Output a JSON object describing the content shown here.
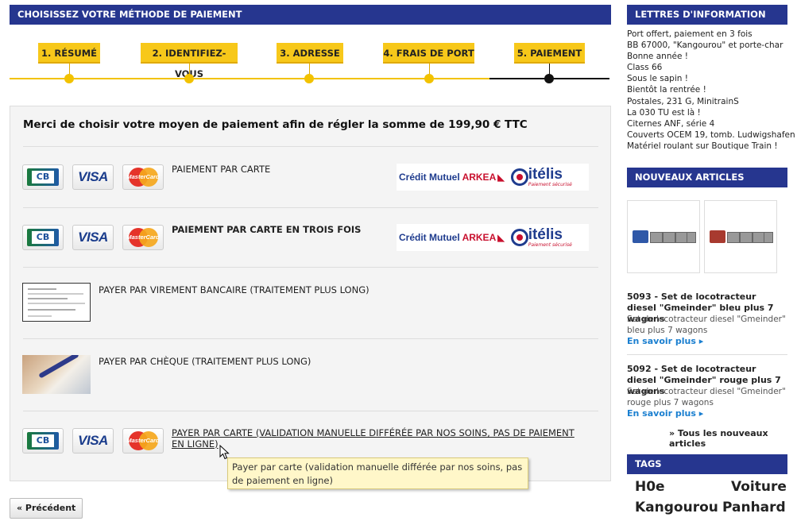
{
  "main": {
    "header": "CHOISISSEZ VOTRE MÉTHODE DE PAIEMENT",
    "steps": [
      {
        "label": "1. RÉSUMÉ"
      },
      {
        "label": "2. IDENTIFIEZ-VOUS"
      },
      {
        "label": "3. ADRESSE"
      },
      {
        "label": "4. FRAIS DE PORT"
      },
      {
        "label": "5. PAIEMENT"
      }
    ],
    "current_step": 5,
    "prompt": "Merci de choisir votre moyen de paiement afin de régler la somme de 199,90 € TTC",
    "options": [
      {
        "label": "PAIEMENT PAR CARTE"
      },
      {
        "label": "PAIEMENT PAR CARTE EN TROIS FOIS"
      },
      {
        "label": "PAYER PAR VIREMENT BANCAIRE (TRAITEMENT PLUS LONG)"
      },
      {
        "label": "PAYER PAR CHÈQUE (TRAITEMENT PLUS LONG)"
      },
      {
        "label_line1": "PAYER PAR CARTE (VALIDATION MANUELLE DIFFÉRÉE PAR NOS SOINS, PAS DE PAIEMENT",
        "label_line2": "EN LIGNE)"
      }
    ],
    "card_logos": {
      "cb": "CB",
      "visa": "VISA",
      "mastercard": "MasterCard"
    },
    "bank_logo": {
      "bank": "Crédit Mutuel",
      "bank_accent": "ARKEA",
      "service": "itélis",
      "service_prefix": "C",
      "service_sub": "Paiement sécurisé"
    },
    "tooltip": "Payer par carte (validation manuelle différée par nos soins, pas de paiement en ligne)",
    "prev_button": "« Précédent"
  },
  "sidebar": {
    "newsletter_header": "LETTRES D'INFORMATION",
    "newsletter_items": [
      "Port offert, paiement en 3 fois",
      "BB 67000, \"Kangourou\" et porte-char",
      "Bonne année !",
      "Class 66",
      "Sous le sapin !",
      "Bientôt la rentrée !",
      "Postales, 231 G, MinitrainS",
      "La 030 TU est là !",
      "Citernes ANF, série 4",
      "Couverts OCEM 19, tomb. Ludwigshafen",
      "Matériel roulant sur Boutique Train !"
    ],
    "new_header": "NOUVEAUX ARTICLES",
    "products": [
      {
        "title": "5093 - Set de locotracteur diesel \"Gmeinder\" bleu plus 7 wagons",
        "desc": "Set de locotracteur diesel \"Gmeinder\" bleu plus 7 wagons",
        "more": "En savoir plus",
        "color": "#2f58a8"
      },
      {
        "title": "5092 - Set de locotracteur diesel \"Gmeinder\" rouge plus 7 wagons",
        "desc": "Set de locotracteur diesel \"Gmeinder\" rouge plus 7 wagons",
        "more": "En savoir plus",
        "color": "#a83a2f"
      }
    ],
    "all_new": "» Tous les nouveaux articles",
    "tags_header": "TAGS",
    "tags": [
      "H0e",
      "Voiture",
      "Kangourou",
      "Panhard"
    ]
  },
  "colors": {
    "header_bg": "#26368f",
    "step_bg": "#f7c81a",
    "link": "#1a7fd0",
    "tooltip_bg": "#fff7c9"
  }
}
